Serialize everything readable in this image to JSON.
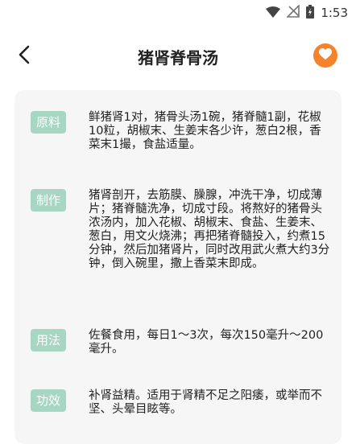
{
  "status": {
    "time": "1:53"
  },
  "header": {
    "title": "猪肾脊骨汤"
  },
  "sections": [
    {
      "label": "原料",
      "text": "鲜猪肾1对，猪骨头汤1碗，猪脊髓1副，花椒10粒，胡椒末、生姜末各少许，葱白2根，香菜末1撮，食盐适量。"
    },
    {
      "label": "制作",
      "text": "猪肾剖开，去筋膜、臊腺，冲洗干净，切成薄片；猪脊髓洗净，切成寸段。将熬好的猪骨头浓汤内，加入花椒、胡椒末、食盐、生姜末、葱白，用文火烧沸；再把猪脊髓投入，约煮15分钟，然后加猪肾片，同时改用武火煮大约3分钟，倒入碗里，撒上香菜末即成。"
    },
    {
      "label": "用法",
      "text": "佐餐食用，每日1～3次，每次150毫升～200毫升。"
    },
    {
      "label": "功效",
      "text": "补肾益精。适用于肾精不足之阳痿，或举而不坚、头晕目眩等。"
    }
  ]
}
